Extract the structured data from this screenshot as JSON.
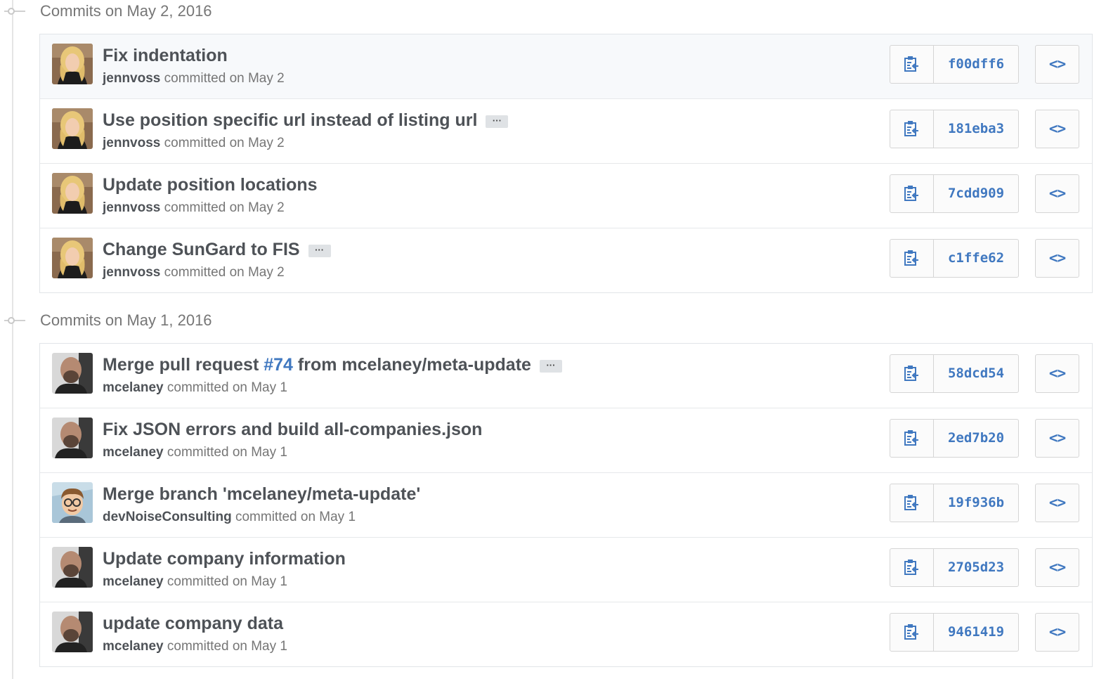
{
  "colors": {
    "link": "#4078c0",
    "text": "#4e5257",
    "muted": "#767676"
  },
  "groups": [
    {
      "title": "Commits on May 2, 2016",
      "commits": [
        {
          "message": "Fix indentation",
          "has_more": false,
          "author": "jennvoss",
          "committed_text": " committed on May 2",
          "sha": "f00dff6",
          "avatar": "blonde-woman",
          "hovered": true
        },
        {
          "message": "Use position specific url instead of listing url",
          "has_more": true,
          "author": "jennvoss",
          "committed_text": " committed on May 2",
          "sha": "181eba3",
          "avatar": "blonde-woman"
        },
        {
          "message": "Update position locations",
          "has_more": false,
          "author": "jennvoss",
          "committed_text": " committed on May 2",
          "sha": "7cdd909",
          "avatar": "blonde-woman"
        },
        {
          "message": "Change SunGard to FIS",
          "has_more": true,
          "author": "jennvoss",
          "committed_text": " committed on May 2",
          "sha": "c1ffe62",
          "avatar": "blonde-woman"
        }
      ]
    },
    {
      "title": "Commits on May 1, 2016",
      "commits": [
        {
          "message_parts": [
            "Merge pull request ",
            "#74",
            " from mcelaney/meta-update"
          ],
          "has_more": true,
          "author": "mcelaney",
          "committed_text": " committed on May 1",
          "sha": "58dcd54",
          "avatar": "bald-man"
        },
        {
          "message": "Fix JSON errors and build all-companies.json",
          "has_more": false,
          "author": "mcelaney",
          "committed_text": " committed on May 1",
          "sha": "2ed7b20",
          "avatar": "bald-man"
        },
        {
          "message": "Merge branch 'mcelaney/meta-update'",
          "has_more": false,
          "author": "devNoiseConsulting",
          "committed_text": " committed on May 1",
          "sha": "19f936b",
          "avatar": "cartoon-glasses"
        },
        {
          "message": "Update company information",
          "has_more": false,
          "author": "mcelaney",
          "committed_text": " committed on May 1",
          "sha": "2705d23",
          "avatar": "bald-man"
        },
        {
          "message": "update company data",
          "has_more": false,
          "author": "mcelaney",
          "committed_text": " committed on May 1",
          "sha": "9461419",
          "avatar": "bald-man"
        }
      ]
    }
  ],
  "icons": {
    "more": "ellipsis-icon",
    "copy": "clipboard-icon",
    "browse": "code-icon"
  },
  "more_glyph": "···",
  "browse_glyph": "<>"
}
